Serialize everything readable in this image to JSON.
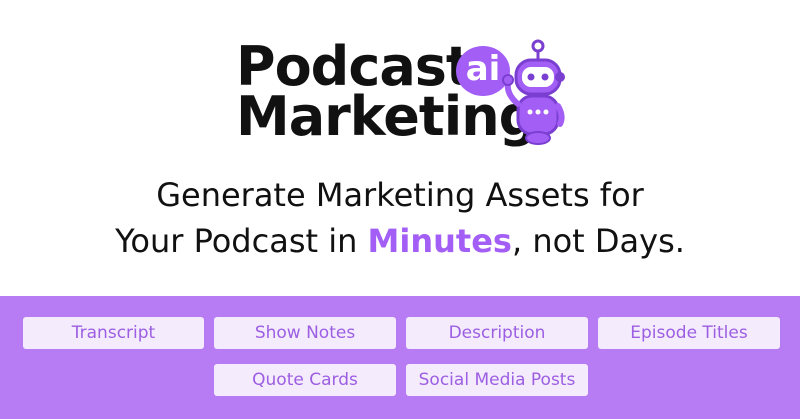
{
  "logo": {
    "line1": "Podcast",
    "line2": "Marketing",
    "badge": "ai"
  },
  "headline": {
    "line1": "Generate Marketing Assets for",
    "line2_pre": "Your Podcast in ",
    "line2_accent": "Minutes",
    "line2_post": ", not Days."
  },
  "features": {
    "transcript": "Transcript",
    "show_notes": "Show Notes",
    "description": "Description",
    "episode_titles": "Episode Titles",
    "quote_cards": "Quote Cards",
    "social_media_posts": "Social Media Posts"
  },
  "colors": {
    "accent": "#a35ff5",
    "band": "#b77cf3",
    "chip_bg": "#f4ebfc",
    "chip_text": "#9c5ee2",
    "text": "#111111"
  },
  "icons": {
    "mascot": "robot-mascot-icon"
  }
}
